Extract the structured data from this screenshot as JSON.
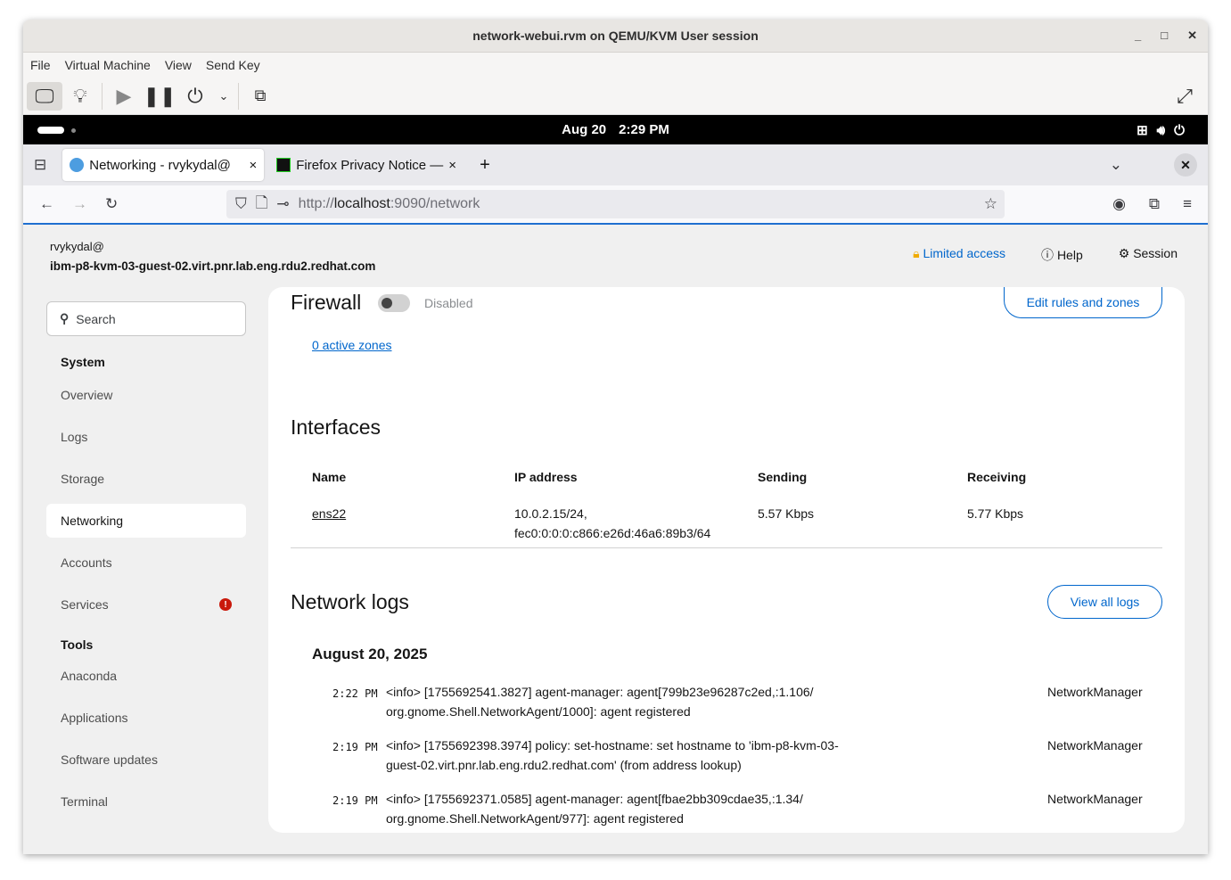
{
  "window": {
    "title": "network-webui.rvm on QEMU/KVM User session",
    "controls": [
      "_",
      "□",
      "✕"
    ]
  },
  "menu": [
    "File",
    "Virtual Machine",
    "View",
    "Send Key"
  ],
  "gnome": {
    "date": "Aug 20",
    "time": "2:29 PM"
  },
  "browser": {
    "tabs": [
      {
        "label": "Networking - rvykydal@"
      },
      {
        "label": "Firefox Privacy Notice —"
      }
    ],
    "url_prefix": "http://",
    "url_host": "localhost",
    "url_rest": ":9090/network"
  },
  "header": {
    "user": "rvykydal@",
    "host": "ibm-p8-kvm-03-guest-02.virt.pnr.lab.eng.rdu2.redhat.com",
    "limited": "Limited access",
    "help": "Help",
    "session": "Session"
  },
  "sidebar": {
    "search_placeholder": "Search",
    "system": "System",
    "system_items": [
      "Overview",
      "Logs",
      "Storage",
      "Networking",
      "Accounts",
      "Services"
    ],
    "tools": "Tools",
    "tool_items": [
      "Anaconda",
      "Applications",
      "Software updates",
      "Terminal"
    ]
  },
  "firewall": {
    "title": "Firewall",
    "state": "Disabled",
    "zones": "0 active zones",
    "edit": "Edit rules and zones"
  },
  "interfaces": {
    "title": "Interfaces",
    "headers": [
      "Name",
      "IP address",
      "Sending",
      "Receiving"
    ],
    "rows": [
      {
        "name": "ens22",
        "ip1": "10.0.2.15/24,",
        "ip2": "fec0:0:0:0:c866:e26d:46a6:89b3/64",
        "sending": "5.57 Kbps",
        "receiving": "5.77 Kbps"
      }
    ]
  },
  "logs": {
    "title": "Network logs",
    "view_all": "View all logs",
    "date": "August 20, 2025",
    "entries": [
      {
        "time": "2:22 PM",
        "l1": "<info> [1755692541.3827] agent-manager: agent[799b23e96287c2ed,:1.106/",
        "l2": "org.gnome.Shell.NetworkAgent/1000]: agent registered",
        "source": "NetworkManager"
      },
      {
        "time": "2:19 PM",
        "l1": "<info> [1755692398.3974] policy: set-hostname: set hostname to 'ibm-p8-kvm-03-",
        "l2": "guest-02.virt.pnr.lab.eng.rdu2.redhat.com' (from address lookup)",
        "source": "NetworkManager"
      },
      {
        "time": "2:19 PM",
        "l1": "<info> [1755692371.0585] agent-manager: agent[fbae2bb309cdae35,:1.34/",
        "l2": "org.gnome.Shell.NetworkAgent/977]: agent registered",
        "source": "NetworkManager"
      }
    ]
  }
}
